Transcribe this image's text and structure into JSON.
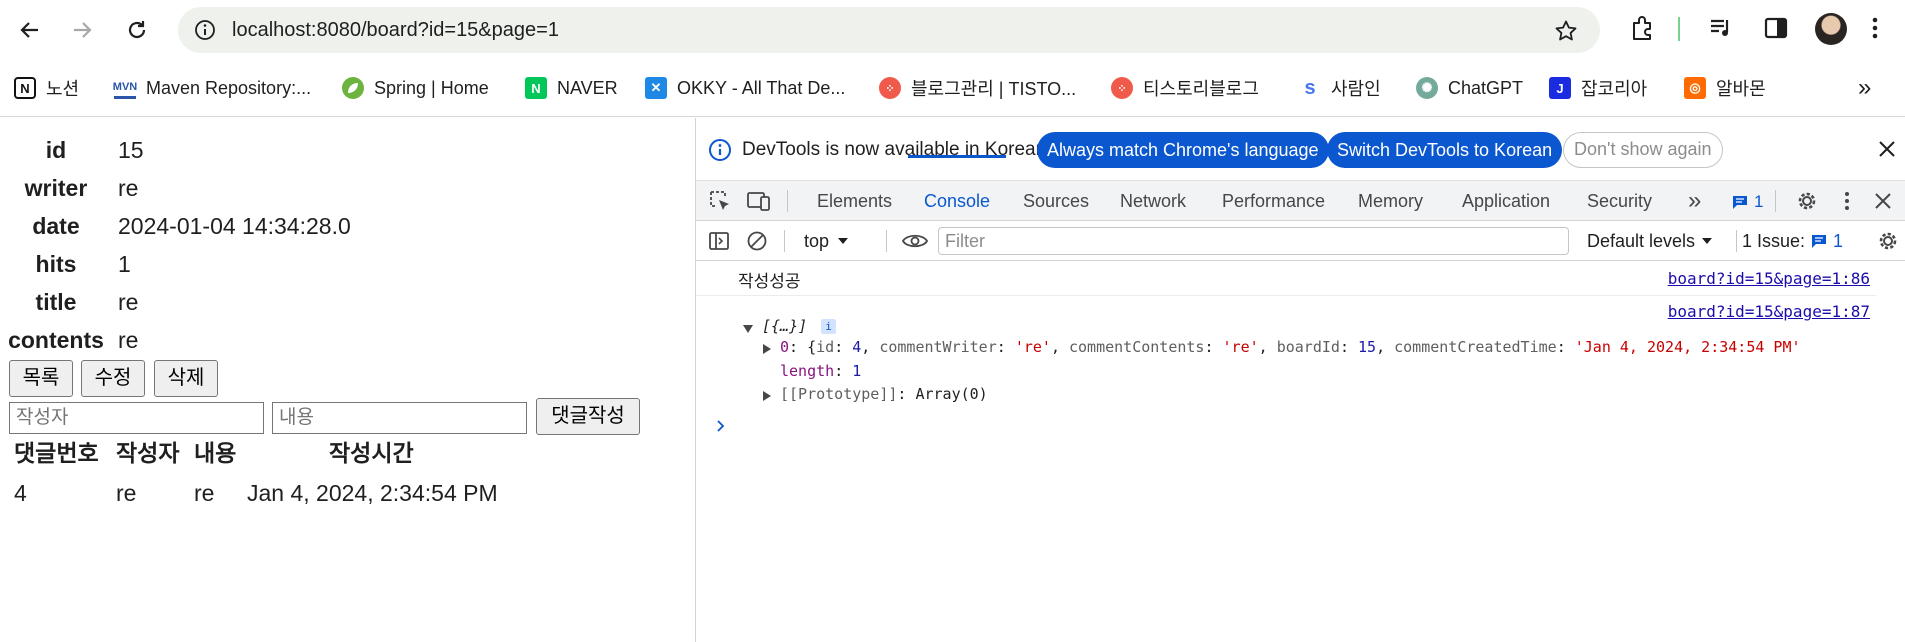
{
  "browser": {
    "url": "localhost:8080/board?id=15&page=1",
    "bookmarks": [
      {
        "label": "노션",
        "icon": "notion-icon"
      },
      {
        "label": "Maven Repository:...",
        "icon": "maven-icon"
      },
      {
        "label": "Spring | Home",
        "icon": "spring-icon"
      },
      {
        "label": "NAVER",
        "icon": "naver-icon"
      },
      {
        "label": "OKKY - All That De...",
        "icon": "okky-icon"
      },
      {
        "label": "블로그관리 | TISTO...",
        "icon": "tistory-icon"
      },
      {
        "label": "티스토리블로그",
        "icon": "tistory-icon"
      },
      {
        "label": "사람인",
        "icon": "saramin-icon"
      },
      {
        "label": "ChatGPT",
        "icon": "chatgpt-icon"
      },
      {
        "label": "잡코리아",
        "icon": "jobkorea-icon"
      },
      {
        "label": "알바몬",
        "icon": "albamon-icon"
      }
    ],
    "overflow_glyph": "»"
  },
  "board": {
    "fields": [
      {
        "label": "id",
        "value": "15"
      },
      {
        "label": "writer",
        "value": "re"
      },
      {
        "label": "date",
        "value": "2024-01-04 14:34:28.0"
      },
      {
        "label": "hits",
        "value": "1"
      },
      {
        "label": "title",
        "value": "re"
      },
      {
        "label": "contents",
        "value": "re"
      }
    ],
    "buttons": {
      "list": "목록",
      "edit": "수정",
      "delete": "삭제"
    },
    "comment_form": {
      "writer_placeholder": "작성자",
      "contents_placeholder": "내용",
      "submit": "댓글작성"
    },
    "comment_table": {
      "headers": [
        "댓글번호",
        "작성자",
        "내용",
        "작성시간"
      ],
      "rows": [
        [
          "4",
          "re",
          "re",
          "Jan 4, 2024, 2:34:54 PM"
        ]
      ]
    }
  },
  "devtools": {
    "infobar": {
      "message": "DevTools is now available in Korean!",
      "match_button": "Always match Chrome's language",
      "switch_button": "Switch DevTools to Korean",
      "dismiss_button": "Don't show again"
    },
    "tabs": [
      "Elements",
      "Console",
      "Sources",
      "Network",
      "Performance",
      "Memory",
      "Application",
      "Security"
    ],
    "active_tab": "Console",
    "more_tabs": "»",
    "issues_badge": "1",
    "filterbar": {
      "context": "top",
      "filter_placeholder": "Filter",
      "levels": "Default levels",
      "issues_label": "1 Issue:",
      "issues_count": "1"
    },
    "console": {
      "log_text": "작성성공",
      "log_source": "board?id=15&page=1:86",
      "array_source": "board?id=15&page=1:87",
      "array_summary": "[{…}]",
      "info_badge": "i",
      "item_index": "0",
      "item_id_key": "id",
      "item_id": "4",
      "item_writer_key": "commentWriter",
      "item_writer": "'re'",
      "item_contents_key": "commentContents",
      "item_contents": "'re'",
      "item_board_key": "boardId",
      "item_board": "15",
      "item_time_key": "commentCreatedTime",
      "item_time": "'Jan 4, 2024, 2:34:54 PM'",
      "length_key": "length",
      "length_value": "1",
      "prototype_key": "[[Prototype]]",
      "prototype_value": "Array(0)"
    }
  },
  "colors": {
    "accent": "#0b57d0",
    "omnibox": "#eef1ec",
    "tab_bar": "#f1f3f4"
  }
}
